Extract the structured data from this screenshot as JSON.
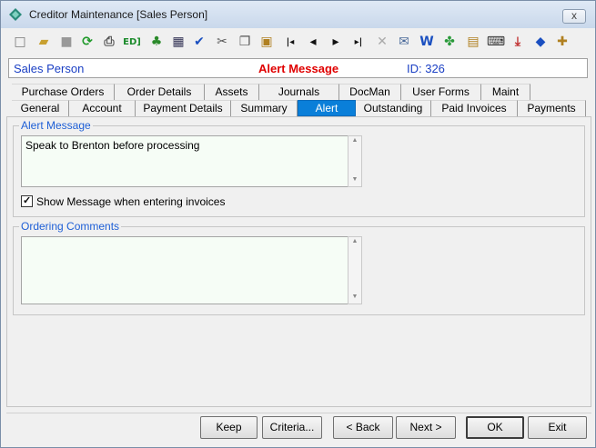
{
  "window": {
    "title": "Creditor Maintenance  [Sales Person]",
    "close_label": "x"
  },
  "toolbar": {
    "items": [
      {
        "name": "new-icon",
        "glyph": "□"
      },
      {
        "name": "open-folder-icon",
        "glyph": "▰"
      },
      {
        "name": "save-icon",
        "glyph": "■"
      },
      {
        "name": "refresh-icon",
        "glyph": "⟳"
      },
      {
        "name": "print-icon",
        "glyph": "⎙"
      },
      {
        "name": "edit-id-icon",
        "glyph": "ED]"
      },
      {
        "name": "tree-icon",
        "glyph": "♣"
      },
      {
        "name": "calculator-icon",
        "glyph": "▦"
      },
      {
        "name": "spellcheck-icon",
        "glyph": "✔"
      },
      {
        "name": "cut-icon",
        "glyph": "✂"
      },
      {
        "name": "copy-icon",
        "glyph": "❐"
      },
      {
        "name": "paste-icon",
        "glyph": "▣"
      },
      {
        "name": "first-record-icon",
        "glyph": "|◂"
      },
      {
        "name": "previous-record-icon",
        "glyph": "◂"
      },
      {
        "name": "next-record-icon",
        "glyph": "▸"
      },
      {
        "name": "last-record-icon",
        "glyph": "▸|"
      },
      {
        "name": "delete-icon",
        "glyph": "✕"
      },
      {
        "name": "email-icon",
        "glyph": "✉"
      },
      {
        "name": "word-icon",
        "glyph": "W"
      },
      {
        "name": "clover-icon",
        "glyph": "✤"
      },
      {
        "name": "notes-icon",
        "glyph": "▤"
      },
      {
        "name": "keyboard-icon",
        "glyph": "⌨"
      },
      {
        "name": "download-icon",
        "glyph": "⤓"
      },
      {
        "name": "tag-icon",
        "glyph": "◆"
      },
      {
        "name": "add-note-icon",
        "glyph": "✚"
      }
    ]
  },
  "info": {
    "left": "Sales Person",
    "middle": "Alert Message",
    "right": "ID: 326"
  },
  "tabs_top": [
    "Purchase Orders",
    "Order Details",
    "Assets",
    "Journals",
    "DocMan",
    "User Forms",
    "Maint"
  ],
  "tabs_bottom": [
    "General",
    "Account",
    "Payment Details",
    "Summary",
    "Alert",
    "Outstanding",
    "Paid Invoices",
    "Payments"
  ],
  "active_tab": "Alert",
  "alert_group": {
    "label": "Alert Message",
    "text": "Speak to Brenton before processing"
  },
  "show_message": {
    "checked": true,
    "label": "Show Message when entering invoices"
  },
  "ordering_group": {
    "label": "Ordering Comments",
    "text": ""
  },
  "buttons": {
    "keep": "Keep",
    "criteria": "Criteria...",
    "back": "< Back",
    "next": "Next >",
    "ok": "OK",
    "exit": "Exit"
  },
  "colors": {
    "accent_blue": "#1a3fc4",
    "alert_red": "#e00000",
    "active_tab": "#0a7fd9",
    "group_label": "#1e5fd6"
  }
}
